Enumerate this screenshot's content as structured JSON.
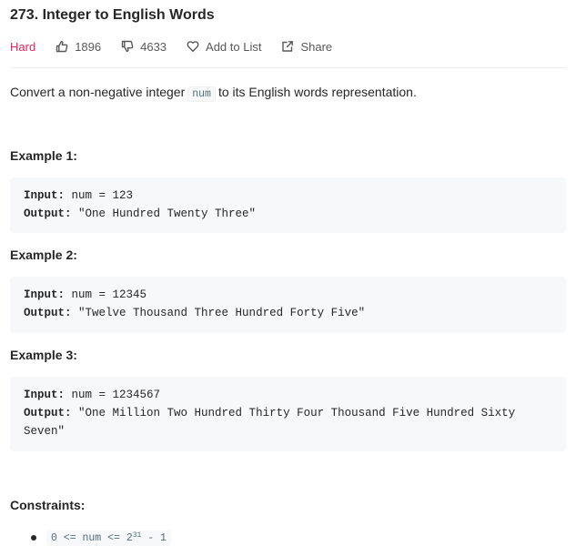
{
  "problem": {
    "title": "273. Integer to English Words",
    "difficulty": "Hard",
    "likes": "1896",
    "dislikes": "4633",
    "add_to_list": "Add to List",
    "share": "Share",
    "colors": {
      "difficulty": "#e0245e",
      "text": "#262626",
      "code_bg": "#f7f8fa"
    }
  },
  "description": {
    "before": "Convert a non-negative integer",
    "code": "num",
    "after": "to its English words representation."
  },
  "labels": {
    "input": "Input:",
    "output": "Output:"
  },
  "examples": [
    {
      "heading": "Example 1:",
      "input": "num = 123",
      "output": "\"One Hundred Twenty Three\""
    },
    {
      "heading": "Example 2:",
      "input": "num = 12345",
      "output": "\"Twelve Thousand Three Hundred Forty Five\""
    },
    {
      "heading": "Example 3:",
      "input": "num = 1234567",
      "output": "\"One Million Two Hundred Thirty Four Thousand Five Hundred Sixty Seven\""
    }
  ],
  "constraints": {
    "heading": "Constraints:",
    "items": [
      {
        "prefix": "0 <= num <= 2",
        "exponent": "31",
        "suffix": " - 1"
      }
    ]
  },
  "icons": {
    "like": "thumbs-up-icon",
    "dislike": "thumbs-down-icon",
    "add": "heart-icon",
    "share": "share-icon"
  }
}
